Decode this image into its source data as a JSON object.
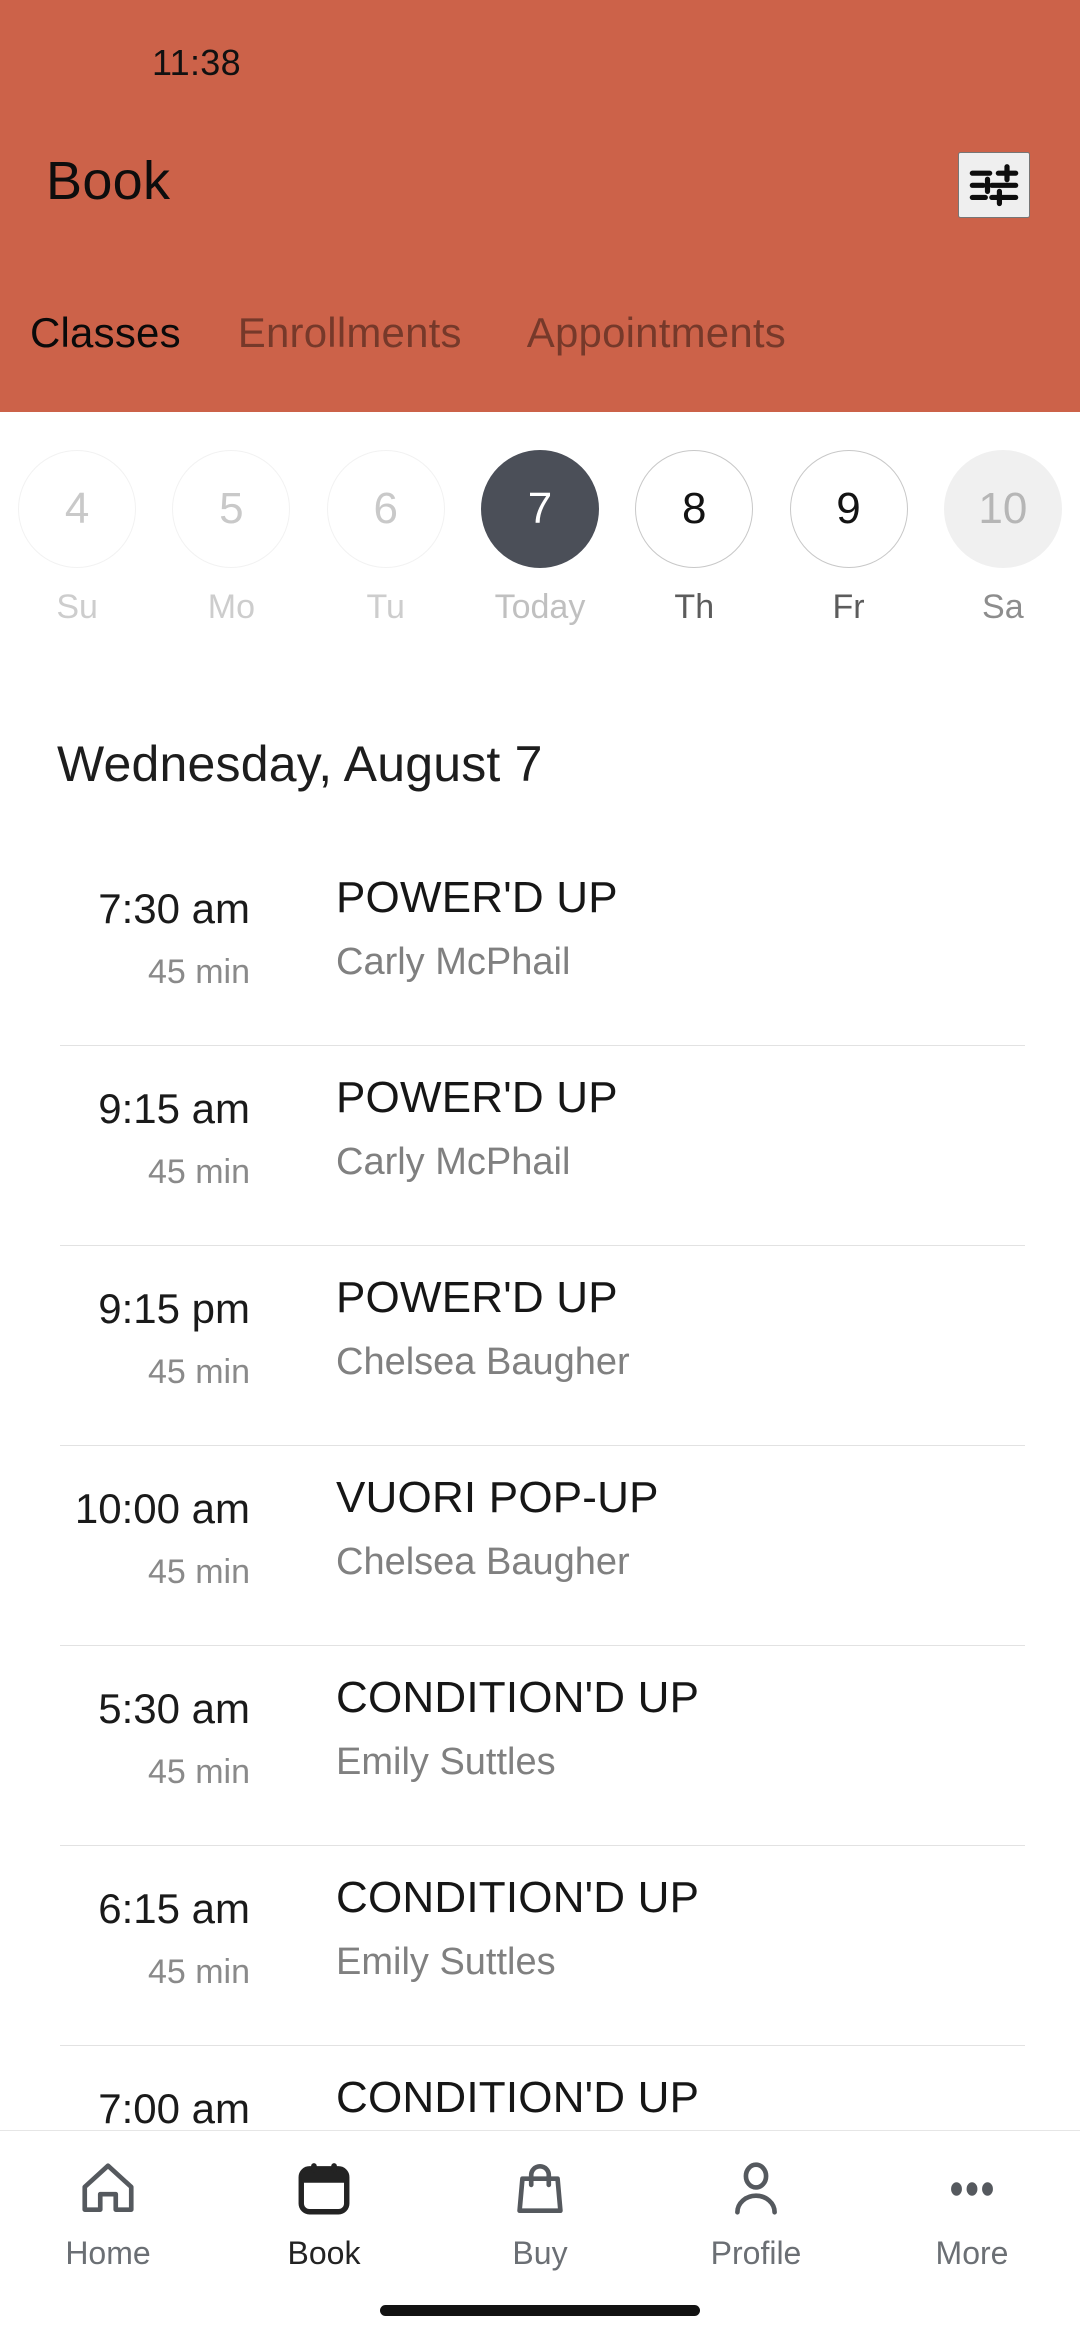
{
  "status_bar": {
    "time": "11:38"
  },
  "header": {
    "title": "Book",
    "accent_color": "#cc6249",
    "filter_icon": "tune-icon",
    "tabs": [
      {
        "label": "Classes",
        "active": true
      },
      {
        "label": "Enrollments",
        "active": false
      },
      {
        "label": "Appointments",
        "active": false
      }
    ]
  },
  "date_strip": {
    "selected_color": "#4b4f58",
    "days": [
      {
        "number": "4",
        "label": "Su",
        "state": "disabled"
      },
      {
        "number": "5",
        "label": "Mo",
        "state": "disabled"
      },
      {
        "number": "6",
        "label": "Tu",
        "state": "disabled"
      },
      {
        "number": "7",
        "label": "Today",
        "state": "today"
      },
      {
        "number": "8",
        "label": "Th",
        "state": "avail"
      },
      {
        "number": "9",
        "label": "Fr",
        "state": "avail"
      },
      {
        "number": "10",
        "label": "Sa",
        "state": "greyfill"
      }
    ]
  },
  "schedule": {
    "day_heading": "Wednesday, August 7",
    "classes": [
      {
        "time": "7:30 am",
        "duration": "45 min",
        "title": "POWER'D UP",
        "instructor": "Carly McPhail"
      },
      {
        "time": "9:15 am",
        "duration": "45 min",
        "title": "POWER'D UP",
        "instructor": "Carly McPhail"
      },
      {
        "time": "9:15 pm",
        "duration": "45 min",
        "title": "POWER'D UP",
        "instructor": "Chelsea Baugher"
      },
      {
        "time": "10:00 am",
        "duration": "45 min",
        "title": "VUORI POP-UP",
        "instructor": "Chelsea Baugher"
      },
      {
        "time": "5:30 am",
        "duration": "45 min",
        "title": "CONDITION'D UP",
        "instructor": "Emily Suttles"
      },
      {
        "time": "6:15 am",
        "duration": "45 min",
        "title": "CONDITION'D UP",
        "instructor": "Emily Suttles"
      },
      {
        "time": "7:00 am",
        "duration": "",
        "title": "CONDITION'D UP",
        "instructor": ""
      }
    ]
  },
  "bottom_nav": {
    "items": [
      {
        "label": "Home",
        "icon": "home-icon",
        "active": false
      },
      {
        "label": "Book",
        "icon": "calendar-icon",
        "active": true
      },
      {
        "label": "Buy",
        "icon": "bag-icon",
        "active": false
      },
      {
        "label": "Profile",
        "icon": "person-icon",
        "active": false
      },
      {
        "label": "More",
        "icon": "dots-icon",
        "active": false
      }
    ]
  }
}
